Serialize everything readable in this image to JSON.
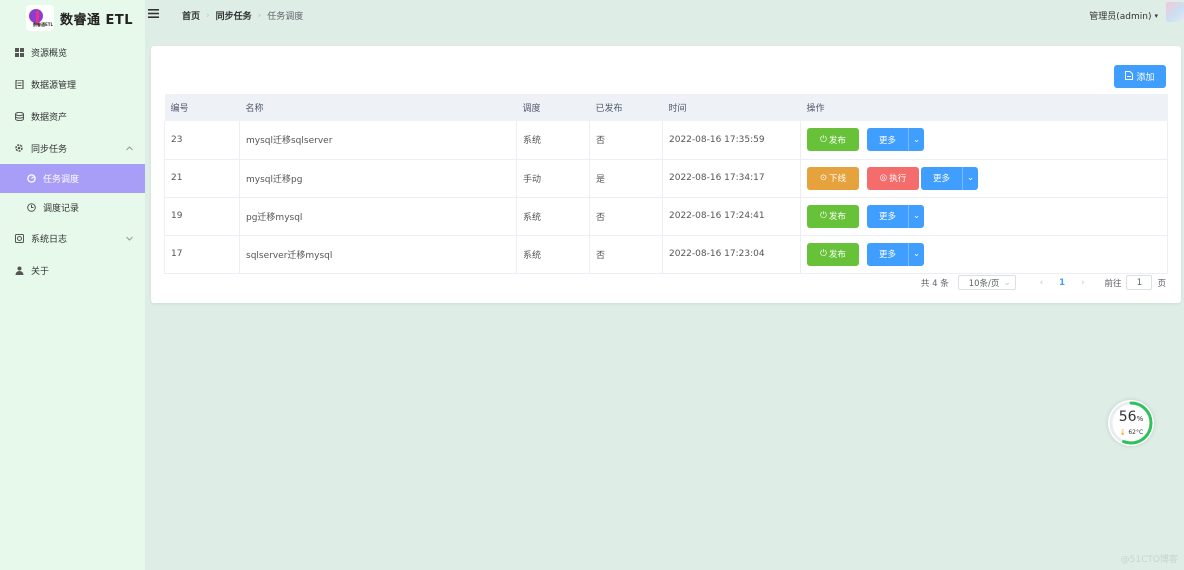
{
  "app": {
    "title": "数睿通 ETL",
    "logo_text": "数睿通ETL"
  },
  "sidebar": {
    "items": [
      {
        "label": "资源概览",
        "icon": "grid-icon"
      },
      {
        "label": "数据源管理",
        "icon": "database-list-icon"
      },
      {
        "label": "数据资产",
        "icon": "stack-icon"
      },
      {
        "label": "同步任务",
        "icon": "gear-icon",
        "expanded": true
      },
      {
        "label": "任务调度",
        "icon": "timer-icon",
        "active": true
      },
      {
        "label": "调度记录",
        "icon": "clock-icon"
      },
      {
        "label": "系统日志",
        "icon": "camera-icon"
      },
      {
        "label": "关于",
        "icon": "user-icon"
      }
    ]
  },
  "header": {
    "breadcrumb": [
      "首页",
      "同步任务",
      "任务调度"
    ],
    "user": "管理员(admin)"
  },
  "toolbar": {
    "add_label": "添加"
  },
  "table": {
    "columns": [
      "编号",
      "名称",
      "调度",
      "已发布",
      "时间",
      "操作"
    ],
    "rows": [
      {
        "id": "23",
        "name": "mysql迁移sqlserver",
        "schedule": "系统",
        "published": "否",
        "time": "2022-08-16 17:35:59"
      },
      {
        "id": "21",
        "name": "mysql迁移pg",
        "schedule": "手动",
        "published": "是",
        "time": "2022-08-16 17:34:17"
      },
      {
        "id": "19",
        "name": "pg迁移mysql",
        "schedule": "系统",
        "published": "否",
        "time": "2022-08-16 17:24:41"
      },
      {
        "id": "17",
        "name": "sqlserver迁移mysql",
        "schedule": "系统",
        "published": "否",
        "time": "2022-08-16 17:23:04"
      }
    ],
    "actions": {
      "publish": "发布",
      "offline": "下线",
      "run": "执行",
      "more": "更多"
    }
  },
  "pagination": {
    "total": "共 4 条",
    "page_size": "10条/页",
    "current": "1",
    "goto_label": "前往",
    "goto_value": "1",
    "page_suffix": "页"
  },
  "widget": {
    "percent": "56",
    "percent_unit": "%",
    "temp": "62°C"
  },
  "watermark": "@51CTO博客",
  "colors": {
    "sidebar_bg": "#e6f9ea",
    "active": "#a89ef7",
    "primary": "#409eff",
    "success": "#67c23a",
    "warning": "#e6a23c",
    "danger": "#f56c6c"
  }
}
